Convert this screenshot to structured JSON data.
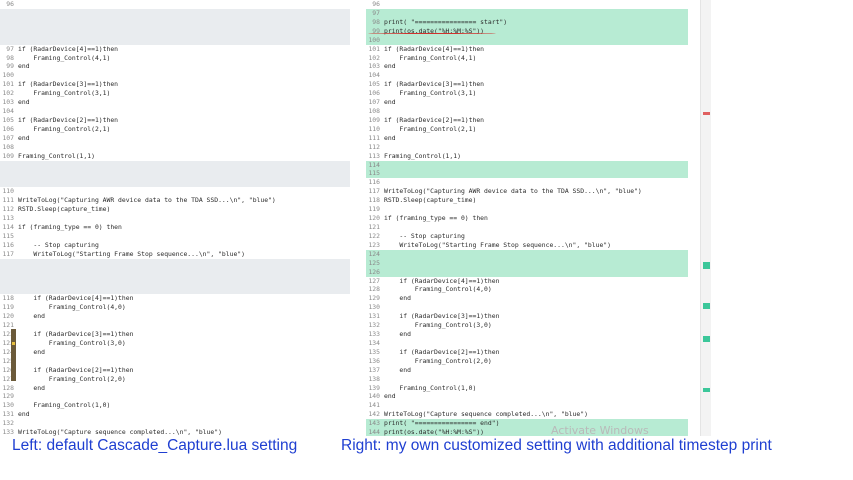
{
  "diff": {
    "left": [
      {
        "type": "line",
        "n": "96",
        "text": ""
      },
      {
        "type": "gap",
        "rows": 4
      },
      {
        "type": "line",
        "n": "97",
        "text": "if (RadarDevice[4]==1)then"
      },
      {
        "type": "line",
        "n": "98",
        "text": "    Framing_Control(4,1)"
      },
      {
        "type": "line",
        "n": "99",
        "text": "end"
      },
      {
        "type": "line",
        "n": "100",
        "text": ""
      },
      {
        "type": "line",
        "n": "101",
        "text": "if (RadarDevice[3]==1)then"
      },
      {
        "type": "line",
        "n": "102",
        "text": "    Framing_Control(3,1)"
      },
      {
        "type": "line",
        "n": "103",
        "text": "end"
      },
      {
        "type": "line",
        "n": "104",
        "text": ""
      },
      {
        "type": "line",
        "n": "105",
        "text": "if (RadarDevice[2]==1)then"
      },
      {
        "type": "line",
        "n": "106",
        "text": "    Framing_Control(2,1)"
      },
      {
        "type": "line",
        "n": "107",
        "text": "end"
      },
      {
        "type": "line",
        "n": "108",
        "text": ""
      },
      {
        "type": "line",
        "n": "109",
        "text": "Framing_Control(1,1)"
      },
      {
        "type": "gap",
        "rows": 3
      },
      {
        "type": "line",
        "n": "110",
        "text": ""
      },
      {
        "type": "line",
        "n": "111",
        "text": "WriteToLog(\"Capturing AWR device data to the TDA SSD...\\n\", \"blue\")"
      },
      {
        "type": "line",
        "n": "112",
        "text": "RSTD.Sleep(capture_time)"
      },
      {
        "type": "line",
        "n": "113",
        "text": ""
      },
      {
        "type": "line",
        "n": "114",
        "text": "if (framing_type == 0) then"
      },
      {
        "type": "line",
        "n": "115",
        "text": ""
      },
      {
        "type": "line",
        "n": "116",
        "text": "    -- Stop capturing"
      },
      {
        "type": "line",
        "n": "117",
        "text": "    WriteToLog(\"Starting Frame Stop sequence...\\n\", \"blue\")"
      },
      {
        "type": "gap",
        "rows": 4
      },
      {
        "type": "line",
        "n": "118",
        "text": "    if (RadarDevice[4]==1)then"
      },
      {
        "type": "line",
        "n": "119",
        "text": "        Framing_Control(4,0)"
      },
      {
        "type": "line",
        "n": "120",
        "text": "    end"
      },
      {
        "type": "line",
        "n": "121",
        "text": ""
      },
      {
        "type": "line",
        "n": "122",
        "text": "    if (RadarDevice[3]==1)then"
      },
      {
        "type": "line",
        "n": "123",
        "text": "        Framing_Control(3,0)"
      },
      {
        "type": "line",
        "n": "124",
        "text": "    end"
      },
      {
        "type": "line",
        "n": "125",
        "text": ""
      },
      {
        "type": "line",
        "n": "126",
        "text": "    if (RadarDevice[2]==1)then"
      },
      {
        "type": "line",
        "n": "127",
        "text": "        Framing_Control(2,0)"
      },
      {
        "type": "line",
        "n": "128",
        "text": "    end"
      },
      {
        "type": "line",
        "n": "129",
        "text": ""
      },
      {
        "type": "line",
        "n": "130",
        "text": "    Framing_Control(1,0)"
      },
      {
        "type": "line",
        "n": "131",
        "text": "end"
      },
      {
        "type": "line",
        "n": "132",
        "text": ""
      },
      {
        "type": "line",
        "n": "133",
        "text": "WriteToLog(\"Capture sequence completed...\\n\", \"blue\")"
      }
    ],
    "right": [
      {
        "type": "line",
        "n": "96",
        "text": ""
      },
      {
        "type": "line",
        "n": "97",
        "text": "",
        "hl": true
      },
      {
        "type": "line",
        "n": "98",
        "text": "print( \"================ start\")",
        "hl": true
      },
      {
        "type": "line",
        "n": "99",
        "text": "print(os.date(\"%H:%M:%S\"))",
        "hl": true
      },
      {
        "type": "line",
        "n": "100",
        "text": "",
        "hl": true
      },
      {
        "type": "line",
        "n": "101",
        "text": "if (RadarDevice[4]==1)then"
      },
      {
        "type": "line",
        "n": "102",
        "text": "    Framing_Control(4,1)"
      },
      {
        "type": "line",
        "n": "103",
        "text": "end"
      },
      {
        "type": "line",
        "n": "104",
        "text": ""
      },
      {
        "type": "line",
        "n": "105",
        "text": "if (RadarDevice[3]==1)then"
      },
      {
        "type": "line",
        "n": "106",
        "text": "    Framing_Control(3,1)"
      },
      {
        "type": "line",
        "n": "107",
        "text": "end"
      },
      {
        "type": "line",
        "n": "108",
        "text": ""
      },
      {
        "type": "line",
        "n": "109",
        "text": "if (RadarDevice[2]==1)then"
      },
      {
        "type": "line",
        "n": "110",
        "text": "    Framing_Control(2,1)"
      },
      {
        "type": "line",
        "n": "111",
        "text": "end"
      },
      {
        "type": "line",
        "n": "112",
        "text": ""
      },
      {
        "type": "line",
        "n": "113",
        "text": "Framing_Control(1,1)"
      },
      {
        "type": "line",
        "n": "114",
        "text": "",
        "hl": true
      },
      {
        "type": "line",
        "n": "115",
        "text": "",
        "hl": true
      },
      {
        "type": "line",
        "n": "116",
        "text": ""
      },
      {
        "type": "line",
        "n": "117",
        "text": "WriteToLog(\"Capturing AWR device data to the TDA SSD...\\n\", \"blue\")"
      },
      {
        "type": "line",
        "n": "118",
        "text": "RSTD.Sleep(capture_time)"
      },
      {
        "type": "line",
        "n": "119",
        "text": ""
      },
      {
        "type": "line",
        "n": "120",
        "text": "if (framing_type == 0) then"
      },
      {
        "type": "line",
        "n": "121",
        "text": ""
      },
      {
        "type": "line",
        "n": "122",
        "text": "    -- Stop capturing"
      },
      {
        "type": "line",
        "n": "123",
        "text": "    WriteToLog(\"Starting Frame Stop sequence...\\n\", \"blue\")"
      },
      {
        "type": "line",
        "n": "124",
        "text": "",
        "hl": true
      },
      {
        "type": "line",
        "n": "125",
        "text": "",
        "hl": true
      },
      {
        "type": "line",
        "n": "126",
        "text": "",
        "hl": true
      },
      {
        "type": "line",
        "n": "127",
        "text": "    if (RadarDevice[4]==1)then"
      },
      {
        "type": "line",
        "n": "128",
        "text": "        Framing_Control(4,0)"
      },
      {
        "type": "line",
        "n": "129",
        "text": "    end"
      },
      {
        "type": "line",
        "n": "130",
        "text": ""
      },
      {
        "type": "line",
        "n": "131",
        "text": "    if (RadarDevice[3]==1)then"
      },
      {
        "type": "line",
        "n": "132",
        "text": "        Framing_Control(3,0)"
      },
      {
        "type": "line",
        "n": "133",
        "text": "    end"
      },
      {
        "type": "line",
        "n": "134",
        "text": ""
      },
      {
        "type": "line",
        "n": "135",
        "text": "    if (RadarDevice[2]==1)then"
      },
      {
        "type": "line",
        "n": "136",
        "text": "        Framing_Control(2,0)"
      },
      {
        "type": "line",
        "n": "137",
        "text": "    end"
      },
      {
        "type": "line",
        "n": "138",
        "text": ""
      },
      {
        "type": "line",
        "n": "139",
        "text": "    Framing_Control(1,0)"
      },
      {
        "type": "line",
        "n": "140",
        "text": "end"
      },
      {
        "type": "line",
        "n": "141",
        "text": ""
      },
      {
        "type": "line",
        "n": "142",
        "text": "WriteToLog(\"Capture sequence completed...\\n\", \"blue\")"
      },
      {
        "type": "line",
        "n": "143",
        "text": "print( \"================ end\")",
        "hl": true
      },
      {
        "type": "line",
        "n": "144",
        "text": "print(os.date(\"%H:%M:%S\"))",
        "hl": true
      },
      {
        "type": "line",
        "n": "145",
        "text": "",
        "hl": true
      }
    ]
  },
  "watermark": "Activate Windows",
  "captions": {
    "left": "Left: default Cascade_Capture.lua setting",
    "right": "Right: my own customized setting with additional timestep print"
  },
  "colors": {
    "added": "#b7ebd3",
    "gap": "#e9ecef",
    "annotation": "#d0312d",
    "caption": "#1f3fd1"
  }
}
